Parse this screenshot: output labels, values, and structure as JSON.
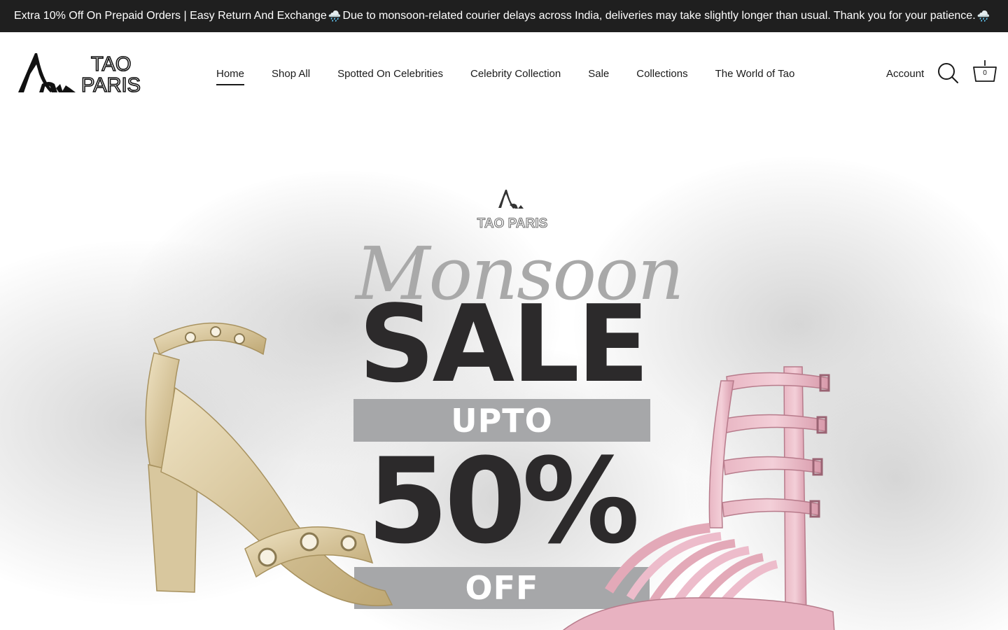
{
  "announcement": {
    "text_part1": "Extra 10% Off On Prepaid Orders | Easy Return And Exchange ",
    "rain_icon": "🌧️",
    "text_part2": "Due to monsoon-related courier delays across India, deliveries may take slightly longer than usual. Thank you for your patience. "
  },
  "brand": {
    "line1": "TAO",
    "line2": "PARIS"
  },
  "nav": {
    "items": [
      {
        "label": "Home",
        "active": true
      },
      {
        "label": "Shop All"
      },
      {
        "label": "Spotted On Celebrities"
      },
      {
        "label": "Celebrity Collection"
      },
      {
        "label": "Sale"
      },
      {
        "label": "Collections"
      },
      {
        "label": "The World of Tao"
      }
    ]
  },
  "header": {
    "account_label": "Account",
    "search_icon": "search-icon",
    "cart_icon": "cart-basket-icon",
    "cart_count": "0"
  },
  "hero": {
    "brand": "TAO PARIS",
    "script_title": "Monsoon",
    "headline": "SALE",
    "upto": "UPTO",
    "discount": "50%",
    "off": "OFF"
  },
  "colors": {
    "announcement_bg": "#1f1f1f",
    "headline": "#2c2a2b",
    "band": "#a6a7a9",
    "script": "#a9a9a9"
  }
}
